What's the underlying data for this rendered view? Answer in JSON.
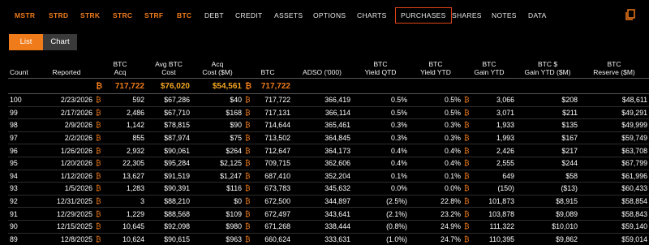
{
  "nav": {
    "tickers": [
      "MSTR",
      "STRD",
      "STRK",
      "STRC",
      "STRF",
      "BTC"
    ],
    "links": [
      "DEBT",
      "CREDIT",
      "ASSETS",
      "OPTIONS",
      "CHARTS",
      "PURCHASES",
      "SHARES",
      "NOTES",
      "DATA"
    ],
    "active": "PURCHASES",
    "copy_icon": "copy-icon"
  },
  "view_toggle": {
    "list": "List",
    "chart": "Chart",
    "selected": "List"
  },
  "btc_symbol": "₿",
  "table": {
    "headers": [
      [
        "",
        "Count"
      ],
      [
        "",
        "Reported"
      ],
      [
        "BTC",
        "Acq"
      ],
      [
        "Avg BTC",
        "Cost"
      ],
      [
        "Acq",
        "Cost ($M)"
      ],
      [
        "",
        "BTC"
      ],
      [
        "",
        "ADSO ('000)"
      ],
      [
        "BTC",
        "Yield QTD"
      ],
      [
        "BTC",
        "Yield YTD"
      ],
      [
        "BTC",
        "Gain YTD"
      ],
      [
        "BTC $",
        "Gain YTD ($M)"
      ],
      [
        "BTC",
        "Reserve ($M)"
      ]
    ],
    "totals": {
      "btc_acq": "717,722",
      "avg_cost": "$76,020",
      "acq_cost": "$54,561",
      "btc": "717,722"
    },
    "rows": [
      {
        "count": "100",
        "reported": "2/23/2026",
        "acq": "592",
        "avg": "$67,286",
        "cost": "$40",
        "btc": "717,722",
        "adso": "366,419",
        "qtd": "0.5%",
        "ytd": "0.5%",
        "gain": "3,066",
        "gain_usd": "$208",
        "reserve": "$48,611"
      },
      {
        "count": "99",
        "reported": "2/17/2026",
        "acq": "2,486",
        "avg": "$67,710",
        "cost": "$168",
        "btc": "717,131",
        "adso": "366,114",
        "qtd": "0.5%",
        "ytd": "0.5%",
        "gain": "3,071",
        "gain_usd": "$211",
        "reserve": "$49,291"
      },
      {
        "count": "98",
        "reported": "2/9/2026",
        "acq": "1,142",
        "avg": "$78,815",
        "cost": "$90",
        "btc": "714,644",
        "adso": "365,461",
        "qtd": "0.3%",
        "ytd": "0.3%",
        "gain": "1,933",
        "gain_usd": "$135",
        "reserve": "$49,999"
      },
      {
        "count": "97",
        "reported": "2/2/2026",
        "acq": "855",
        "avg": "$87,974",
        "cost": "$75",
        "btc": "713,502",
        "adso": "364,845",
        "qtd": "0.3%",
        "ytd": "0.3%",
        "gain": "1,993",
        "gain_usd": "$167",
        "reserve": "$59,749"
      },
      {
        "count": "96",
        "reported": "1/26/2026",
        "acq": "2,932",
        "avg": "$90,061",
        "cost": "$264",
        "btc": "712,647",
        "adso": "364,173",
        "qtd": "0.4%",
        "ytd": "0.4%",
        "gain": "2,426",
        "gain_usd": "$217",
        "reserve": "$63,708"
      },
      {
        "count": "95",
        "reported": "1/20/2026",
        "acq": "22,305",
        "avg": "$95,284",
        "cost": "$2,125",
        "btc": "709,715",
        "adso": "362,606",
        "qtd": "0.4%",
        "ytd": "0.4%",
        "gain": "2,555",
        "gain_usd": "$244",
        "reserve": "$67,799"
      },
      {
        "count": "94",
        "reported": "1/12/2026",
        "acq": "13,627",
        "avg": "$91,519",
        "cost": "$1,247",
        "btc": "687,410",
        "adso": "352,204",
        "qtd": "0.1%",
        "ytd": "0.1%",
        "gain": "649",
        "gain_usd": "$58",
        "reserve": "$61,996"
      },
      {
        "count": "93",
        "reported": "1/5/2026",
        "acq": "1,283",
        "avg": "$90,391",
        "cost": "$116",
        "btc": "673,783",
        "adso": "345,632",
        "qtd": "0.0%",
        "ytd": "0.0%",
        "gain": "(150)",
        "gain_usd": "($13)",
        "reserve": "$60,433"
      },
      {
        "count": "92",
        "reported": "12/31/2025",
        "acq": "3",
        "avg": "$88,210",
        "cost": "$0",
        "btc": "672,500",
        "adso": "344,897",
        "qtd": "(2.5%)",
        "ytd": "22.8%",
        "gain": "101,873",
        "gain_usd": "$8,915",
        "reserve": "$58,854"
      },
      {
        "count": "91",
        "reported": "12/29/2025",
        "acq": "1,229",
        "avg": "$88,568",
        "cost": "$109",
        "btc": "672,497",
        "adso": "343,641",
        "qtd": "(2.1%)",
        "ytd": "23.2%",
        "gain": "103,878",
        "gain_usd": "$9,089",
        "reserve": "$58,843"
      },
      {
        "count": "90",
        "reported": "12/15/2025",
        "acq": "10,645",
        "avg": "$92,098",
        "cost": "$980",
        "btc": "671,268",
        "adso": "338,444",
        "qtd": "(0.8%)",
        "ytd": "24.9%",
        "gain": "111,322",
        "gain_usd": "$10,010",
        "reserve": "$59,140"
      },
      {
        "count": "89",
        "reported": "12/8/2025",
        "acq": "10,624",
        "avg": "$90,615",
        "cost": "$963",
        "btc": "660,624",
        "adso": "333,631",
        "qtd": "(1.0%)",
        "ytd": "24.7%",
        "gain": "110,395",
        "gain_usd": "$9,862",
        "reserve": "$59,014"
      }
    ]
  }
}
